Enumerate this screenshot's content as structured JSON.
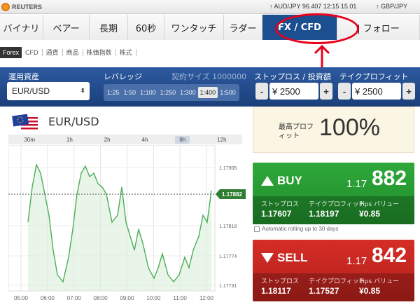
{
  "brand": "REUTERS",
  "ticker": {
    "text": "↑ AUD/JPY 96.407 12:15 15.01",
    "next": "↑ GBP/JPY"
  },
  "nav": {
    "tabs": [
      {
        "label": "バイナリ",
        "w": 62
      },
      {
        "label": "ベアー",
        "w": 66
      },
      {
        "label": "長期",
        "w": 55
      },
      {
        "label": "60秒",
        "w": 52
      },
      {
        "label": "ワンタッチ",
        "w": 85
      },
      {
        "label": "ラダー",
        "w": 55
      },
      {
        "label": "FX / CFD",
        "w": 107
      },
      {
        "label": "| フォロー",
        "w": 118
      }
    ],
    "active": "FX / CFD"
  },
  "subnav": [
    "Forex",
    "CFD",
    "通貨",
    "商品",
    "株価指数",
    "株式"
  ],
  "controls": {
    "asset_label": "運用資産",
    "asset_value": "EUR/USD",
    "leverage_label": "レバレッジ",
    "contract_label": "契約サイズ 1000000",
    "leverages": [
      "1:25",
      "1:50",
      "1:100",
      "1:250",
      "1:300",
      "1:400",
      "1:500"
    ],
    "leverage_selected": "1:400",
    "stoploss_label": "ストップロス / 投資額",
    "stoploss_value": "¥ 2500",
    "takeprofit_label": "テイクプロフィット",
    "takeprofit_value": "¥ 2500",
    "minus": "-",
    "plus": "+"
  },
  "pair": "EUR/USD",
  "timeframes": [
    "30m",
    "1h",
    "2h",
    "4h",
    "8h",
    "12h"
  ],
  "timeframe_selected": "8h",
  "chart_data": {
    "type": "line",
    "x": [
      "05:00",
      "06:00",
      "07:00",
      "08:00",
      "09:00",
      "10:00",
      "11:00",
      "12:00"
    ],
    "ticks": [
      "1.17905",
      "1.17818",
      "1.17774",
      "1.17731"
    ],
    "current": "1.17882",
    "series_color": "#4cae5a"
  },
  "probability": {
    "label": "最高プロフィット",
    "value": "100%"
  },
  "buy": {
    "label": "BUY",
    "price_small": "1.17",
    "price_big": "882",
    "stop_label": "ストップロス",
    "stop_value": "1.17607",
    "tp_label": "テイクプロフィット",
    "tp_value": "1.18197",
    "pips_label": "Pips バリュー",
    "pips_value": "¥0.85"
  },
  "rolling": "Automatic rolling up to 30 days",
  "sell": {
    "label": "SELL",
    "price_small": "1.17",
    "price_big": "842",
    "stop_label": "ストップロス",
    "stop_value": "1.18117",
    "tp_label": "テイクプロフィット",
    "tp_value": "1.17527",
    "pips_label": "Pips バリュー",
    "pips_value": "¥0.85"
  }
}
